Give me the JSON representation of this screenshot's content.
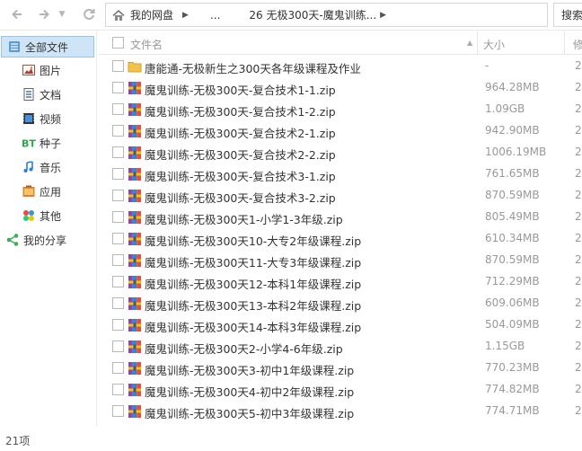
{
  "toolbar": {
    "back_icon": "back-arrow-icon",
    "forward_icon": "forward-arrow-icon",
    "refresh_icon": "refresh-icon",
    "home_icon": "home-icon",
    "breadcrumb_root": "我的网盘",
    "breadcrumb_ellipsis": "...",
    "breadcrumb_current": "26 无极300天-魔鬼训练...",
    "search_label": "搜索"
  },
  "sidebar": {
    "items": [
      {
        "label": "全部文件",
        "icon": "all-files-icon",
        "active": true
      },
      {
        "label": "图片",
        "icon": "image-icon"
      },
      {
        "label": "文档",
        "icon": "document-icon"
      },
      {
        "label": "视频",
        "icon": "video-icon"
      },
      {
        "label": "种子",
        "icon": "bt-icon"
      },
      {
        "label": "音乐",
        "icon": "music-icon"
      },
      {
        "label": "应用",
        "icon": "app-icon"
      },
      {
        "label": "其他",
        "icon": "other-icon"
      },
      {
        "label": "我的分享",
        "icon": "share-icon"
      }
    ]
  },
  "list": {
    "columns": {
      "name": "文件名",
      "size": "大小",
      "modified": "修"
    },
    "rows": [
      {
        "name": "唐能通-无极新生之300天各年级课程及作业",
        "size": "-",
        "mod": "2",
        "type": "folder"
      },
      {
        "name": "魔鬼训练-无极300天-复合技术1-1.zip",
        "size": "964.28MB",
        "mod": "2",
        "type": "zip"
      },
      {
        "name": "魔鬼训练-无极300天-复合技术1-2.zip",
        "size": "1.09GB",
        "mod": "2",
        "type": "zip"
      },
      {
        "name": "魔鬼训练-无极300天-复合技术2-1.zip",
        "size": "942.90MB",
        "mod": "2",
        "type": "zip"
      },
      {
        "name": "魔鬼训练-无极300天-复合技术2-2.zip",
        "size": "1006.19MB",
        "mod": "2",
        "type": "zip"
      },
      {
        "name": "魔鬼训练-无极300天-复合技术3-1.zip",
        "size": "761.65MB",
        "mod": "2",
        "type": "zip"
      },
      {
        "name": "魔鬼训练-无极300天-复合技术3-2.zip",
        "size": "870.59MB",
        "mod": "2",
        "type": "zip"
      },
      {
        "name": "魔鬼训练-无极300天1-小学1-3年级.zip",
        "size": "805.49MB",
        "mod": "2",
        "type": "zip"
      },
      {
        "name": "魔鬼训练-无极300天10-大专2年级课程.zip",
        "size": "610.34MB",
        "mod": "2",
        "type": "zip"
      },
      {
        "name": "魔鬼训练-无极300天11-大专3年级课程.zip",
        "size": "870.59MB",
        "mod": "2",
        "type": "zip"
      },
      {
        "name": "魔鬼训练-无极300天12-本科1年级课程.zip",
        "size": "712.29MB",
        "mod": "2",
        "type": "zip"
      },
      {
        "name": "魔鬼训练-无极300天13-本科2年级课程.zip",
        "size": "609.06MB",
        "mod": "2",
        "type": "zip"
      },
      {
        "name": "魔鬼训练-无极300天14-本科3年级课程.zip",
        "size": "504.09MB",
        "mod": "2",
        "type": "zip"
      },
      {
        "name": "魔鬼训练-无极300天2-小学4-6年级.zip",
        "size": "1.15GB",
        "mod": "2",
        "type": "zip"
      },
      {
        "name": "魔鬼训练-无极300天3-初中1年级课程.zip",
        "size": "770.23MB",
        "mod": "2",
        "type": "zip"
      },
      {
        "name": "魔鬼训练-无极300天4-初中2年级课程.zip",
        "size": "774.82MB",
        "mod": "2",
        "type": "zip"
      },
      {
        "name": "魔鬼训练-无极300天5-初中3年级课程.zip",
        "size": "774.71MB",
        "mod": "2",
        "type": "zip"
      }
    ]
  },
  "status": {
    "count_text": "21项"
  }
}
